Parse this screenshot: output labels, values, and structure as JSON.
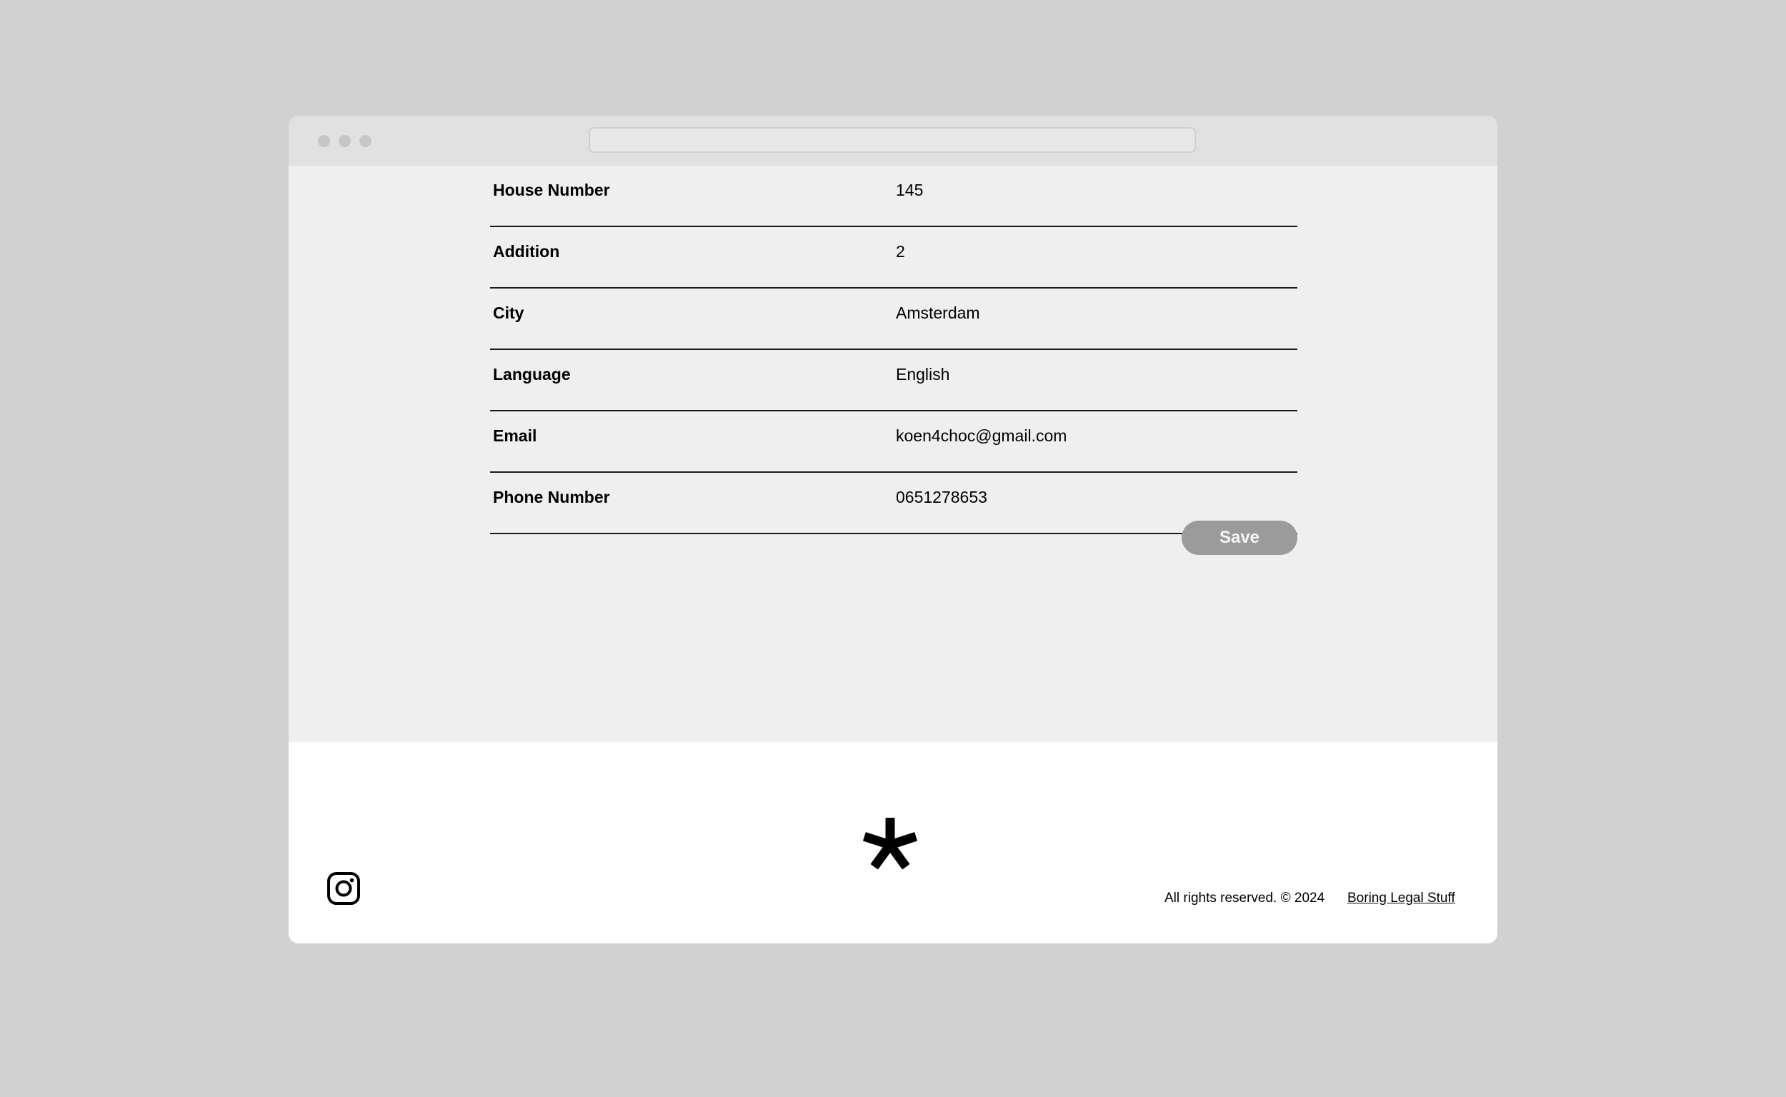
{
  "form": {
    "rows": [
      {
        "label": "House Number",
        "value": "145"
      },
      {
        "label": "Addition",
        "value": "2"
      },
      {
        "label": "City",
        "value": "Amsterdam"
      },
      {
        "label": "Language",
        "value": "English"
      },
      {
        "label": "Email",
        "value": "koen4choc@gmail.com"
      },
      {
        "label": "Phone Number",
        "value": "0651278653"
      }
    ],
    "save_label": "Save"
  },
  "footer": {
    "copyright": "All rights reserved. © 2024",
    "legal_link": "Boring Legal Stuff",
    "social_icon": "instagram-icon",
    "logo_icon": "asterisk-icon"
  },
  "colors": {
    "page_bg": "#d1d1d1",
    "window_bg": "#efefef",
    "titlebar_bg": "#e1e1e1",
    "footer_bg": "#ffffff",
    "save_button_bg": "#9b9b9b"
  }
}
